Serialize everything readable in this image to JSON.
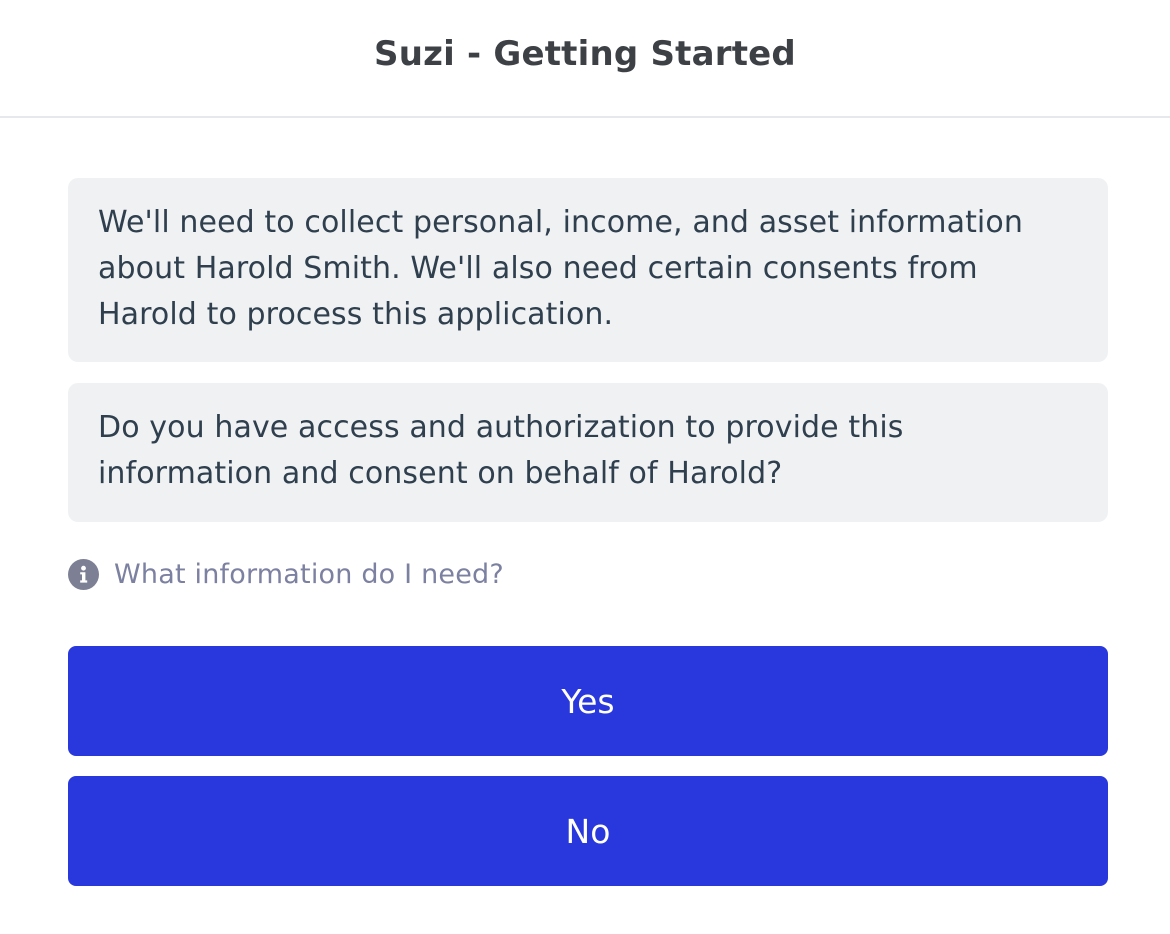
{
  "header": {
    "title": "Suzi - Getting Started"
  },
  "messages": [
    {
      "text": "We'll need to collect personal, income, and asset information about Harold Smith. We'll also need certain consents from Harold to process this application."
    },
    {
      "text": "Do you have access and authorization to provide this information and consent on behalf of Harold?"
    }
  ],
  "info_link": {
    "icon": "info-icon",
    "label": "What information do I need?"
  },
  "buttons": {
    "yes_label": "Yes",
    "no_label": "No"
  },
  "colors": {
    "primary_button": "#2838dd",
    "bubble_background": "#eff1f3",
    "link_text": "#7d81a1",
    "title_text": "#3d4146",
    "body_text": "#2f3f4e"
  }
}
